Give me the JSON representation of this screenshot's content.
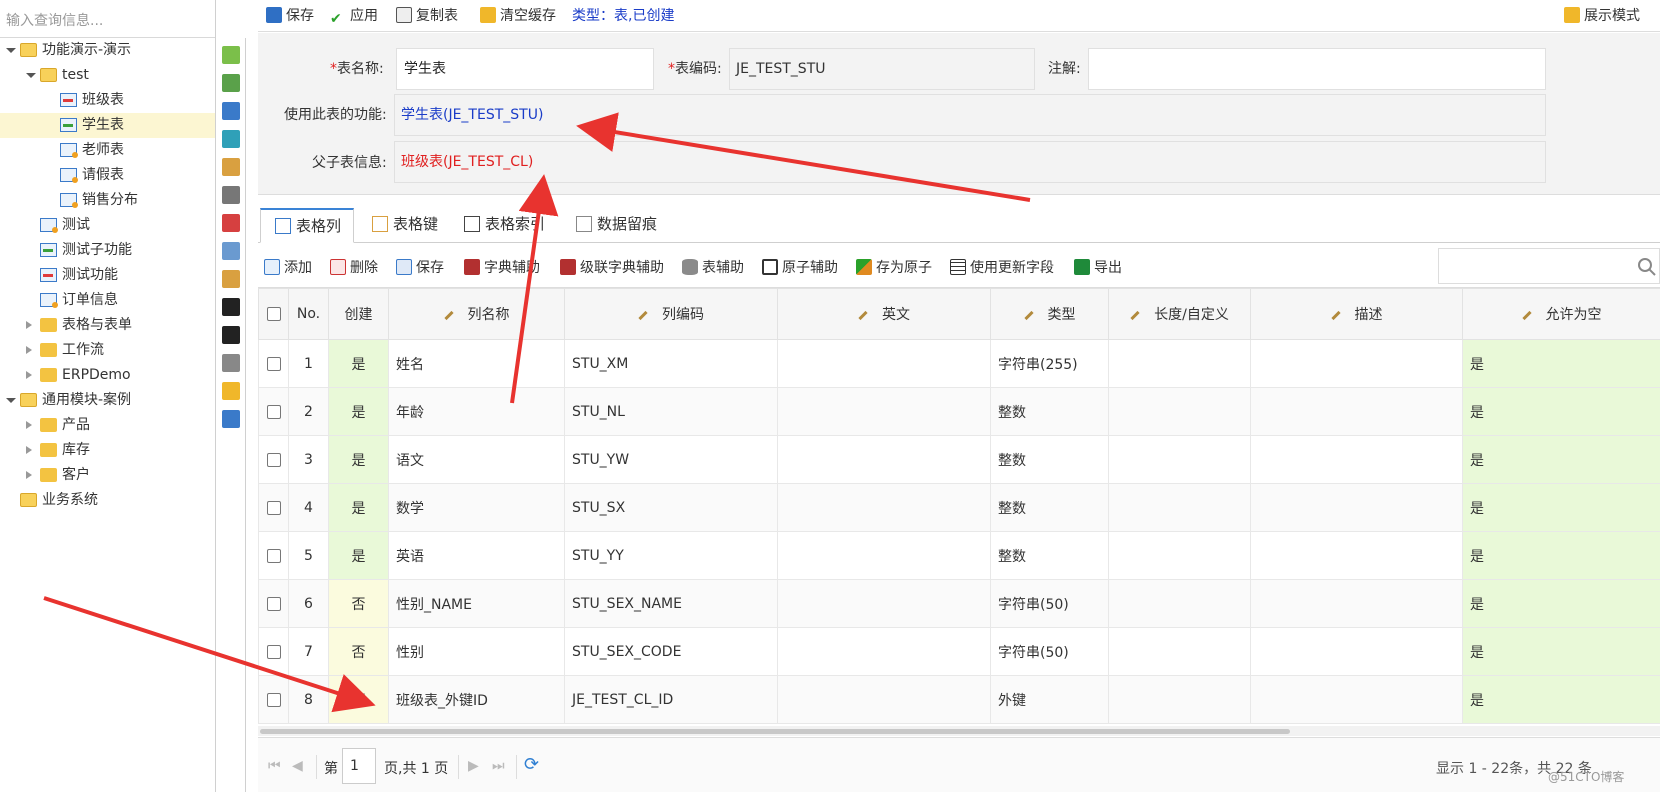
{
  "left": {
    "search_placeholder": "输入查询信息...",
    "tree": [
      {
        "label": "功能演示-演示",
        "level": 0,
        "kind": "folder-open",
        "expander": "open"
      },
      {
        "label": "test",
        "level": 1,
        "kind": "folder-open",
        "expander": "open"
      },
      {
        "label": "班级表",
        "level": 2,
        "kind": "table-red"
      },
      {
        "label": "学生表",
        "level": 2,
        "kind": "table-green",
        "selected": true
      },
      {
        "label": "老师表",
        "level": 2,
        "kind": "table-orange"
      },
      {
        "label": "请假表",
        "level": 2,
        "kind": "table-orange"
      },
      {
        "label": "销售分布",
        "level": 2,
        "kind": "table-orange"
      },
      {
        "label": "测试",
        "level": 1,
        "kind": "table-orange"
      },
      {
        "label": "测试子功能",
        "level": 1,
        "kind": "table-green"
      },
      {
        "label": "测试功能",
        "level": 1,
        "kind": "table-red"
      },
      {
        "label": "订单信息",
        "level": 1,
        "kind": "table-orange"
      },
      {
        "label": "表格与表单",
        "level": 1,
        "kind": "folder",
        "expander": "closed"
      },
      {
        "label": "工作流",
        "level": 1,
        "kind": "folder",
        "expander": "closed"
      },
      {
        "label": "ERPDemo",
        "level": 1,
        "kind": "folder",
        "expander": "closed"
      },
      {
        "label": "通用模块-案例",
        "level": 0,
        "kind": "folder-open",
        "expander": "open"
      },
      {
        "label": "产品",
        "level": 1,
        "kind": "folder",
        "expander": "closed"
      },
      {
        "label": "库存",
        "level": 1,
        "kind": "folder",
        "expander": "closed"
      },
      {
        "label": "客户",
        "level": 1,
        "kind": "folder",
        "expander": "closed"
      },
      {
        "label": "业务系统",
        "level": 0,
        "kind": "folder-open"
      }
    ],
    "strip_icons": [
      "add-folder-icon",
      "add-table-icon",
      "add-view-icon",
      "add-column-icon",
      "paste-icon",
      "delete-icon",
      "remove-icon",
      "import-icon",
      "refresh-icon",
      "sql-icon",
      "sql-icon",
      "database-export-icon",
      "broom-icon",
      "transfer-icon"
    ]
  },
  "toolbar": {
    "save": "保存",
    "apply": "应用",
    "copy_table": "复制表",
    "clear_cache": "清空缓存",
    "type_label": "类型：表,已创建",
    "display_mode": "展示模式"
  },
  "form": {
    "table_name_label": "表名称:",
    "table_name_value": "学生表",
    "table_code_label": "表编码:",
    "table_code_value": "JE_TEST_STU",
    "comment_label": "注解:",
    "comment_value": "",
    "used_by_label": "使用此表的功能:",
    "used_by_value": "学生表(JE_TEST_STU)",
    "parent_child_label": "父子表信息:",
    "parent_child_value": "班级表(JE_TEST_CL)"
  },
  "tabs": [
    {
      "label": "表格列",
      "active": true
    },
    {
      "label": "表格键"
    },
    {
      "label": "表格索引"
    },
    {
      "label": "数据留痕"
    }
  ],
  "grid_toolbar": {
    "add": "添加",
    "delete": "删除",
    "save": "保存",
    "dict_helper": "字典辅助",
    "cascade_dict_helper": "级联字典辅助",
    "table_helper": "表辅助",
    "atom_helper": "原子辅助",
    "save_as_atom": "存为原子",
    "use_update_field": "使用更新字段",
    "export": "导出"
  },
  "grid": {
    "columns": [
      "No.",
      "创建",
      "列名称",
      "列编码",
      "英文",
      "类型",
      "长度/自定义",
      "描述",
      "允许为空"
    ],
    "rows": [
      {
        "no": "1",
        "created": "是",
        "name": "姓名",
        "code": "STU_XM",
        "en": "",
        "type": "字符串(255)",
        "len": "",
        "desc": "",
        "nullable": "是"
      },
      {
        "no": "2",
        "created": "是",
        "name": "年龄",
        "code": "STU_NL",
        "en": "",
        "type": "整数",
        "len": "",
        "desc": "",
        "nullable": "是"
      },
      {
        "no": "3",
        "created": "是",
        "name": "语文",
        "code": "STU_YW",
        "en": "",
        "type": "整数",
        "len": "",
        "desc": "",
        "nullable": "是"
      },
      {
        "no": "4",
        "created": "是",
        "name": "数学",
        "code": "STU_SX",
        "en": "",
        "type": "整数",
        "len": "",
        "desc": "",
        "nullable": "是"
      },
      {
        "no": "5",
        "created": "是",
        "name": "英语",
        "code": "STU_YY",
        "en": "",
        "type": "整数",
        "len": "",
        "desc": "",
        "nullable": "是"
      },
      {
        "no": "6",
        "created": "否",
        "name": "性别_NAME",
        "code": "STU_SEX_NAME",
        "en": "",
        "type": "字符串(50)",
        "len": "",
        "desc": "",
        "nullable": "是"
      },
      {
        "no": "7",
        "created": "否",
        "name": "性别",
        "code": "STU_SEX_CODE",
        "en": "",
        "type": "字符串(50)",
        "len": "",
        "desc": "",
        "nullable": "是"
      },
      {
        "no": "8",
        "created": "否",
        "name": "班级表_外键ID",
        "code": "JE_TEST_CL_ID",
        "en": "",
        "type": "外键",
        "len": "",
        "desc": "",
        "nullable": "是"
      }
    ]
  },
  "pager": {
    "page_prefix": "第",
    "page_value": "1",
    "page_suffix": "页,共 1 页",
    "summary": "显示 1 - 22条，共 22 条"
  },
  "watermark": "@51CTO博客",
  "colors": {
    "link_blue": "#1a3cc8",
    "link_red": "#e02020",
    "accent": "#3a83d6",
    "created_yes_bg": "#e9f9d8",
    "created_no_bg": "#fbfbde",
    "arrow": "#e8332f"
  }
}
